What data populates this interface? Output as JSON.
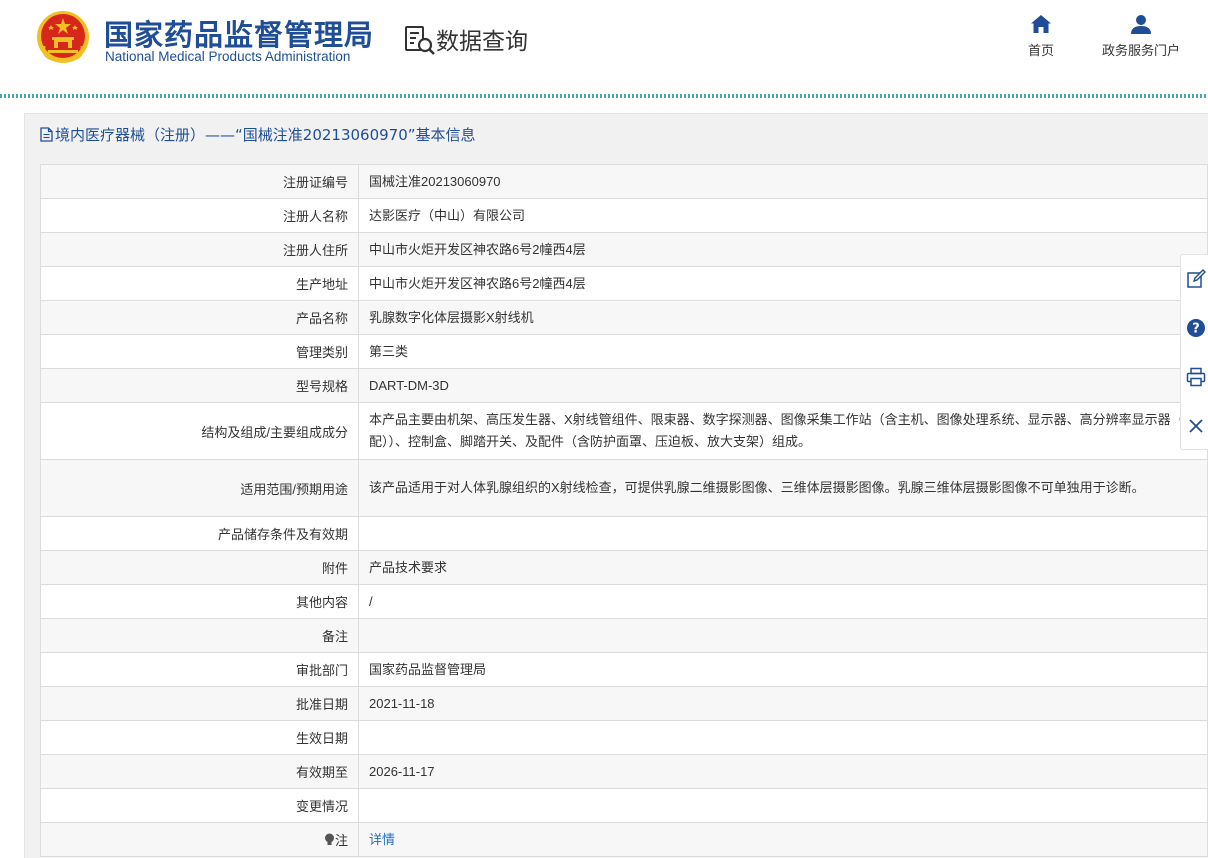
{
  "header": {
    "org_name_cn": "国家药品监督管理局",
    "org_name_en": "National Medical Products Administration",
    "section_title": "数据查询",
    "nav": {
      "home_label": "首页",
      "service_label": "政务服务门户"
    }
  },
  "panel": {
    "title": "境内医疗器械（注册）——“国械注准20213060970”基本信息"
  },
  "rows": [
    {
      "label": "注册证编号",
      "value": "国械注准20213060970"
    },
    {
      "label": "注册人名称",
      "value": "达影医疗（中山）有限公司"
    },
    {
      "label": "注册人住所",
      "value": "中山市火炬开发区神农路6号2幢西4层"
    },
    {
      "label": "生产地址",
      "value": "中山市火炬开发区神农路6号2幢西4层"
    },
    {
      "label": "产品名称",
      "value": "乳腺数字化体层摄影X射线机"
    },
    {
      "label": "管理类别",
      "value": "第三类"
    },
    {
      "label": "型号规格",
      "value": "DART-DM-3D"
    },
    {
      "label": "结构及组成/主要组成成分",
      "value": "本产品主要由机架、高压发生器、X射线管组件、限束器、数字探测器、图像采集工作站（含主机、图像处理系统、显示器、高分辨率显示器（选配））、控制盒、脚踏开关、及配件（含防护面罩、压迫板、放大支架）组成。"
    },
    {
      "label": "适用范围/预期用途",
      "value": "该产品适用于对人体乳腺组织的X射线检查，可提供乳腺二维摄影图像、三维体层摄影图像。乳腺三维体层摄影图像不可单独用于诊断。"
    },
    {
      "label": "产品储存条件及有效期",
      "value": ""
    },
    {
      "label": "附件",
      "value": "产品技术要求"
    },
    {
      "label": "其他内容",
      "value": "/"
    },
    {
      "label": "备注",
      "value": ""
    },
    {
      "label": "审批部门",
      "value": "国家药品监督管理局"
    },
    {
      "label": "批准日期",
      "value": "2021-11-18"
    },
    {
      "label": "生效日期",
      "value": ""
    },
    {
      "label": "有效期至",
      "value": "2026-11-17"
    },
    {
      "label": "变更情况",
      "value": ""
    }
  ],
  "note_row": {
    "label": "注",
    "link_text": "详情"
  },
  "colors": {
    "brand_blue": "#1f4e96",
    "link_blue": "#1f6fc4",
    "emblem_red": "#d7261b",
    "emblem_gold": "#f2c025"
  },
  "icons": [
    "national-emblem-icon",
    "search-document-icon",
    "home-icon",
    "user-icon",
    "document-icon",
    "lightbulb-icon",
    "edit-icon",
    "help-icon",
    "print-icon",
    "close-icon"
  ]
}
